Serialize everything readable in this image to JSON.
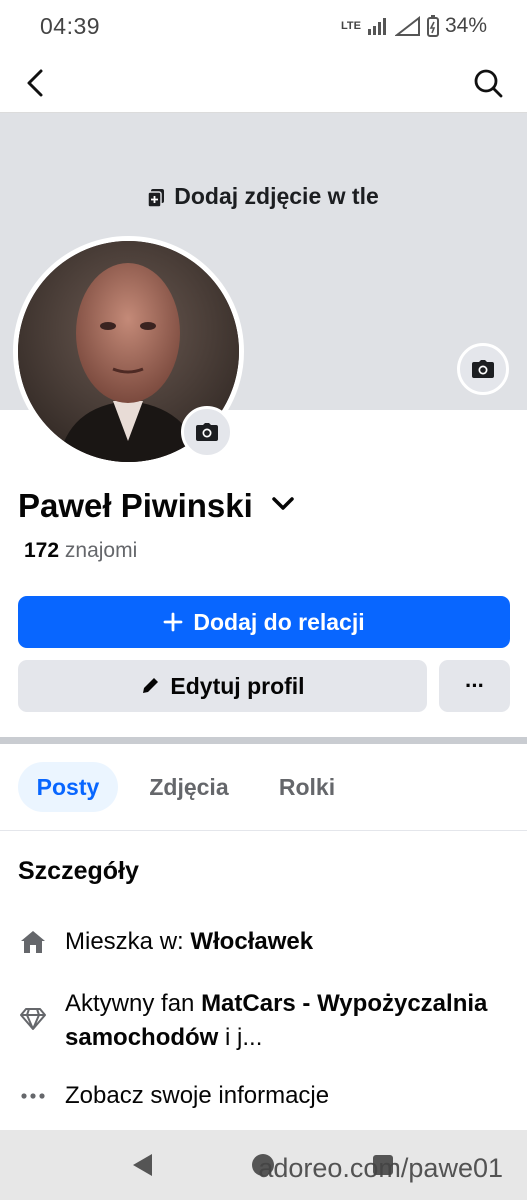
{
  "status": {
    "time": "04:39",
    "network": "LTE",
    "battery": "34%"
  },
  "nav": {
    "back_icon": "back-arrow-icon",
    "search_icon": "search-icon"
  },
  "cover": {
    "add_label": "Dodaj zdjęcie w tle"
  },
  "profile": {
    "name": "Paweł Piwinski",
    "friends_count": "172",
    "friends_label": "znajomi"
  },
  "actions": {
    "add_story": "Dodaj do relacji",
    "edit_profile": "Edytuj profil",
    "more": "···"
  },
  "tabs": [
    {
      "label": "Posty",
      "active": true
    },
    {
      "label": "Zdjęcia",
      "active": false
    },
    {
      "label": "Rolki",
      "active": false
    }
  ],
  "details": {
    "title": "Szczegóły",
    "lives_prefix": "Mieszka w: ",
    "lives_city": "Włocławek",
    "fan_prefix": "Aktywny fan ",
    "fan_page": "MatCars - Wypożyczalnia samochodów",
    "fan_suffix": " i j...",
    "see_info": "Zobacz swoje informacje"
  },
  "watermark": "adoreo.com/pawe01",
  "colors": {
    "accent": "#0866ff",
    "secondary_btn": "#e4e6eb",
    "cover": "#dfe1e5"
  }
}
